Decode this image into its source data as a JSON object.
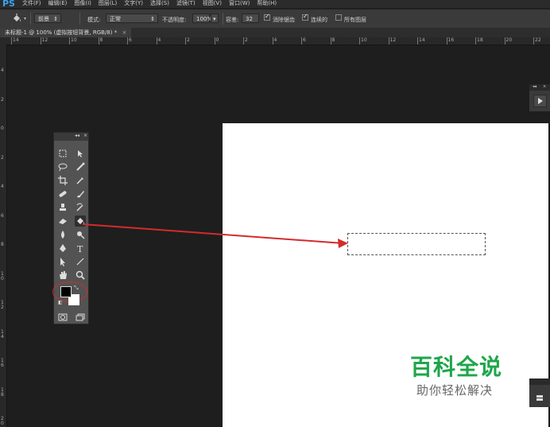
{
  "app": {
    "logo": "PS"
  },
  "menu": [
    "文件(F)",
    "编辑(E)",
    "图像(I)",
    "图层(L)",
    "文字(Y)",
    "选择(S)",
    "滤镜(T)",
    "视图(V)",
    "窗口(W)",
    "帮助(H)"
  ],
  "options": {
    "tool_icon": "paint-bucket-icon",
    "fill_source": "前景",
    "mode_label": "模式:",
    "mode_value": "正常",
    "opacity_label": "不透明度:",
    "opacity_value": "100%",
    "tolerance_label": "容差:",
    "tolerance_value": "32",
    "antialias_label": "消除锯齿",
    "antialias_checked": true,
    "contiguous_label": "连续的",
    "contiguous_checked": true,
    "all_layers_label": "所有图层",
    "all_layers_checked": false
  },
  "document_tab": {
    "title": "未标题-1 @ 100% (虚拟按钮背景, RGB/8) *",
    "close": "×"
  },
  "ruler_h_labels": [
    "14",
    "12",
    "10",
    "8",
    "6",
    "4",
    "2",
    "0",
    "2",
    "4",
    "6",
    "8",
    "10",
    "12",
    "14",
    "16",
    "18",
    "20",
    "22"
  ],
  "ruler_v_labels": [
    "4",
    "2",
    "0",
    "2",
    "4",
    "6",
    "8",
    "1 0",
    "1 2",
    "1 4",
    "1 6",
    "1 8",
    "2 0"
  ],
  "toolbox": {
    "header_collapse": "◂◂",
    "header_close": "×",
    "tools": [
      [
        "rect-marquee-icon",
        "move-icon"
      ],
      [
        "lasso-icon",
        "quick-select-icon"
      ],
      [
        "crop-icon",
        "eyedropper-icon"
      ],
      [
        "healing-brush-icon",
        "brush-icon"
      ],
      [
        "clone-stamp-icon",
        "history-brush-icon"
      ],
      [
        "eraser-icon",
        "paint-bucket-icon"
      ],
      [
        "blur-icon",
        "dodge-icon"
      ],
      [
        "pen-icon",
        "type-icon"
      ],
      [
        "path-select-icon",
        "line-icon"
      ],
      [
        "hand-icon",
        "zoom-icon"
      ]
    ],
    "bottom": [
      "quick-mask-icon",
      "screen-mode-icon"
    ]
  },
  "colors": {
    "foreground": "#000000",
    "background": "#ffffff",
    "annotation": "#d42b2b",
    "watermark": "#1ea64a"
  },
  "right_panel": {
    "header_collapse": "◂◂",
    "header_close": "×",
    "play_icon": "play-icon"
  },
  "watermark": {
    "title": "百科全说",
    "subtitle": "助你轻松解决"
  }
}
